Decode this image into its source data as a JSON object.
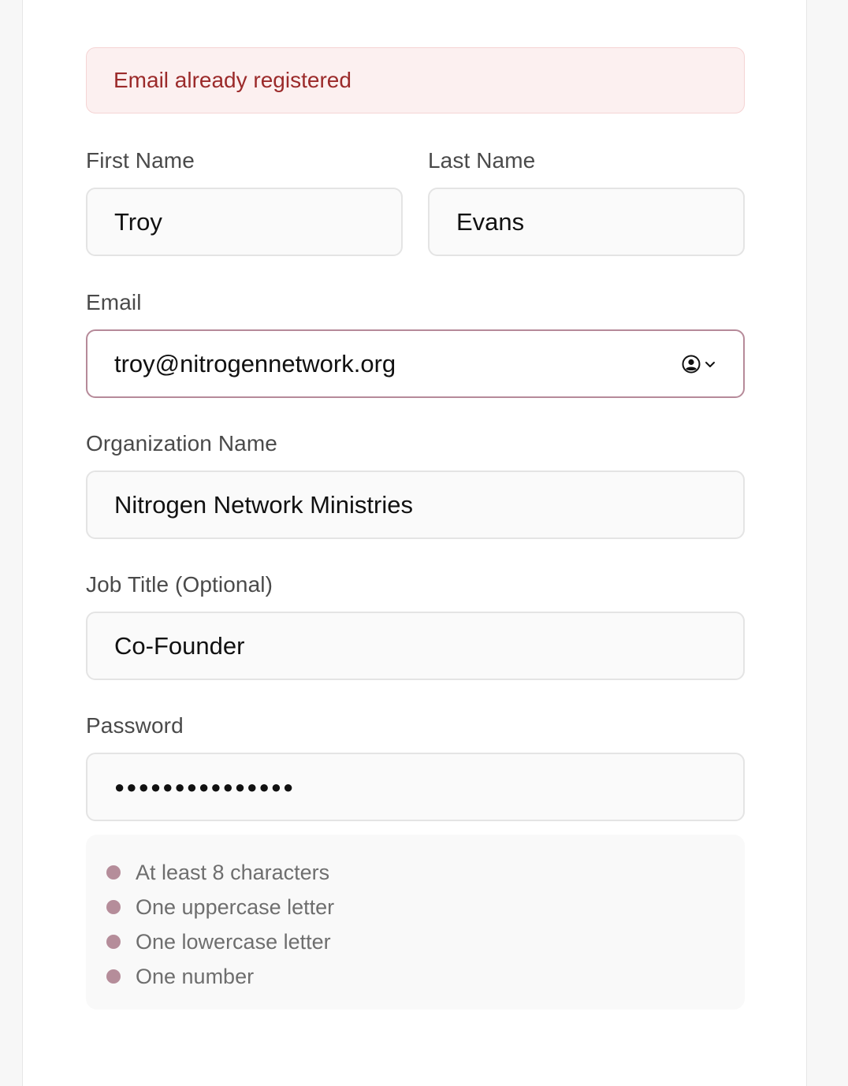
{
  "alert": {
    "message": "Email already registered"
  },
  "fields": {
    "first_name": {
      "label": "First Name",
      "value": "Troy"
    },
    "last_name": {
      "label": "Last Name",
      "value": "Evans"
    },
    "email": {
      "label": "Email",
      "value": "troy@nitrogennetwork.org",
      "autofill_icon": "contact-card-icon"
    },
    "organization": {
      "label": "Organization Name",
      "value": "Nitrogen Network Ministries"
    },
    "job_title": {
      "label": "Job Title (Optional)",
      "value": "Co-Founder"
    },
    "password": {
      "label": "Password",
      "masked_value": "●●●●●●●●●●●●●●●"
    }
  },
  "password_requirements": [
    {
      "text": "At least 8 characters"
    },
    {
      "text": "One uppercase letter"
    },
    {
      "text": "One lowercase letter"
    },
    {
      "text": "One number"
    }
  ],
  "colors": {
    "accent": "#b58d9a",
    "error_text": "#9b2a2a",
    "error_bg": "#fcf0f0"
  }
}
